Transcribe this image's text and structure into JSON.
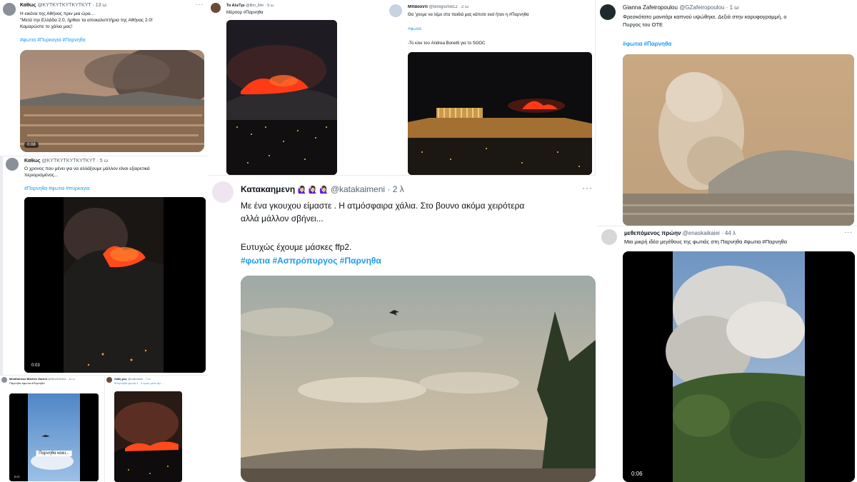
{
  "t1": {
    "name": "Καθώς",
    "handle": "@KYTKYTKYTKYTKYT · 13 ω",
    "line1": "Η εικόνα της Αθήνας πριν μια ώρα...",
    "line2": "\"Μετά την Ελλάδα 2.0, ήρθαν τα αποκαλυπτήρια της Αθήνας 2.0!",
    "line3": "Καμαρώστε το χάλια μας!",
    "tags": "#φωτια #Πυρκαγια #Παρνηθα",
    "video_time": "0:08"
  },
  "t2": {
    "name": "Καθώς",
    "handle": "@KYTKYTKYTKYTKYT · 5 ω",
    "line1": "Ο χρονος που μένει για να αλλάξουμε μάλλον είναι εξαιρετικά",
    "line2": "περιορισμένος...",
    "tags": "#Παρνηθα #φωτια #πυρκαγια",
    "video_time": "0:03"
  },
  "t3": {
    "name": "Το ΑλεΤρι",
    "handle": "@lllm_lllm · 9 ω",
    "line1": "Μόριτορ #Παρνηθα"
  },
  "t4": {
    "name": "Μπάουντι",
    "handle": "@teregismw12 · 2 ω",
    "line1": "Θα 'χουμε να λέμε στα παιδιά μας κάποτε εκεί ήταν η #Παρνηθα",
    "tags": "#φωτια",
    "line2": "-Το κλικ του Andrea Bonetti για το SOOC"
  },
  "t5": {
    "name": "Gianna Zafeiropoulou",
    "handle": "@GZafeiropoulou · 1 ω",
    "line1": "Φρεσκότατο μανιτάρι καπνού υψώθηκε. Δεξιά στην κορυφογραμμή, ο",
    "line2": "Πυργος του ΟΤΕ",
    "tags": "#φωτια #Παρνηθα"
  },
  "t6": {
    "name": "Κατακαημενη",
    "emoji": "🙋🏻‍♀️ 🙋🏻‍♀️ 🙋🏻‍♀️",
    "handle": "@katakaimeni · 2 λ",
    "line1": "Με ένα γκουχου είμαστε . Η ατμόσφαιρα χάλια. Στο βουνο ακόμα χειρότερα",
    "line2": "αλλά μάλλον σβήνει...",
    "line3": "Ευτυχώς έχουμε μάσκες ffp2.",
    "tags": "#φωτια #Ασπρόπυργος #Παρνηθα",
    "more": "···"
  },
  "t7": {
    "name": "μεθεπόμενος πρώην",
    "handle": "@enaskaikaiei · 44 λ",
    "line1": "Μια μικρή ιδέα μεγέθους της φωτιάς στη Παρνηθα #φωτια #Παρνηθα",
    "video_time": "0:06",
    "more": "···"
  },
  "t8": {
    "name": "Mindfulness Bitches Garnet",
    "handle": "@MindOfHere · 11 ω",
    "line1": "Παρνηθα #φωτια #Παρνηθα",
    "caption": "Παρνηθα καιει...",
    "video_time": "0:07"
  },
  "t9": {
    "name": "Λάθη μας",
    "handle": "@Lakhmisrr · 7 ω",
    "line1": "#Παρνηθα φωτιά 2 - 3 ώρες μετά την ..."
  },
  "colors": {
    "link": "#1d9bf0",
    "fire": "#ff4a1c",
    "muted": "#536471"
  }
}
